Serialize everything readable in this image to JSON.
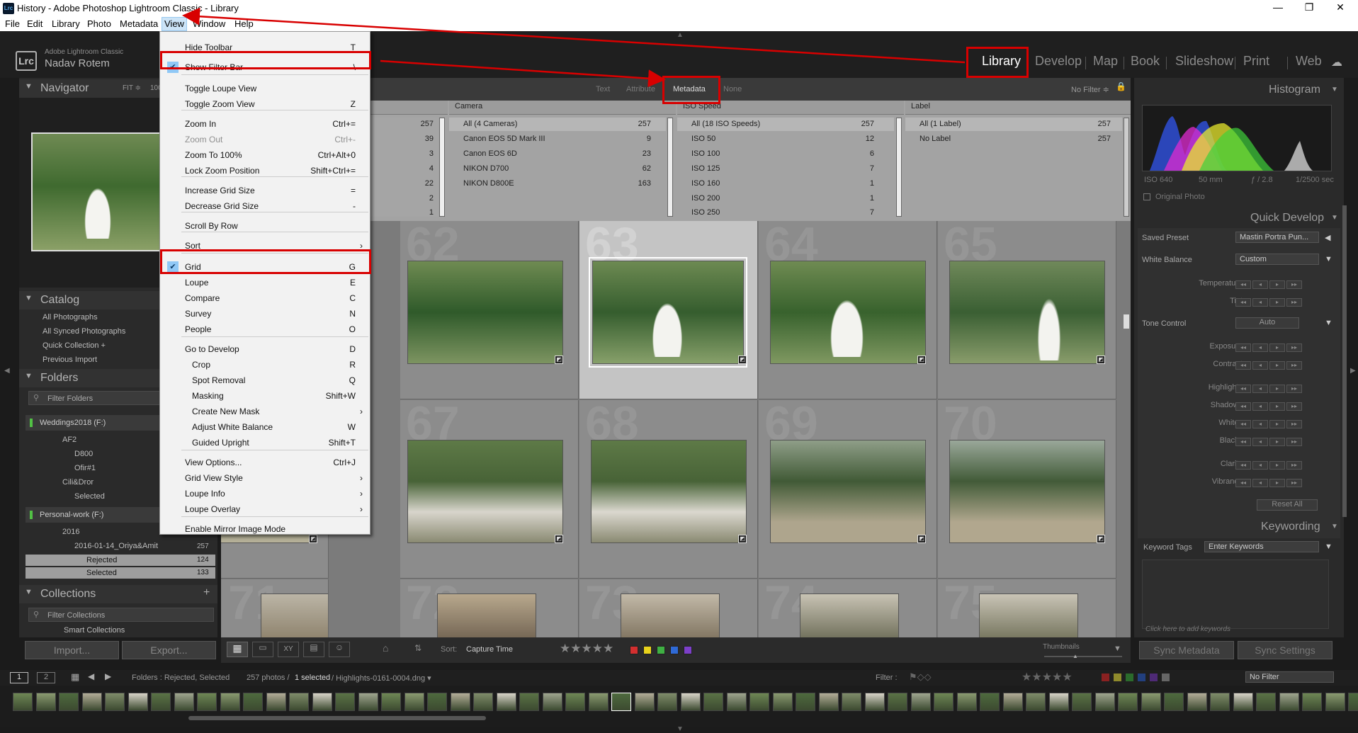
{
  "window": {
    "title": "History - Adobe Photoshop Lightroom Classic - Library",
    "minimize": "—",
    "maximize": "❐",
    "close": "✕"
  },
  "menubar": [
    "File",
    "Edit",
    "Library",
    "Photo",
    "Metadata",
    "View",
    "Window",
    "Help"
  ],
  "identity": {
    "app": "Adobe Lightroom Classic",
    "user": "Nadav Rotem",
    "logo": "Lrc"
  },
  "modules": [
    "Library",
    "Develop",
    "Map",
    "Book",
    "Slideshow",
    "Print",
    "Web"
  ],
  "navigator": {
    "title": "Navigator",
    "zoom_fit": "FIT ≑",
    "zoom_100": "100"
  },
  "catalog": {
    "title": "Catalog",
    "items": [
      "All Photographs",
      "All Synced Photographs",
      "Quick Collection  +",
      "Previous Import"
    ]
  },
  "folders": {
    "title": "Folders",
    "filter": "Filter Folders",
    "volume1": "Weddings2018 (F:)",
    "volume2": "Personal-work (F:)",
    "tree": [
      "AF2",
      "D800",
      "Ofir#1",
      "Cili&Dror",
      "Selected",
      "2016",
      "2016-01-14_Oriya&Amit",
      "Rejected",
      "Selected"
    ],
    "counts": [
      "257",
      "124",
      "133"
    ]
  },
  "collections": {
    "title": "Collections",
    "filter": "Filter Collections",
    "item": "Smart Collections"
  },
  "buttons": {
    "import": "Import...",
    "export": "Export..."
  },
  "filter_bar": {
    "text": "Text",
    "attribute": "Attribute",
    "metadata": "Metadata",
    "none": "None",
    "preset": "No Filter ≑"
  },
  "metadata": {
    "col0_counts": [
      "257",
      "39",
      "3",
      "4",
      "22",
      "2",
      "1"
    ],
    "camera": {
      "header": "Camera",
      "rows": [
        "All (4 Cameras)",
        "Canon EOS 5D Mark III",
        "Canon EOS 6D",
        "NIKON D700",
        "NIKON D800E"
      ],
      "counts": [
        "257",
        "9",
        "23",
        "62",
        "163"
      ]
    },
    "iso": {
      "header": "ISO Speed",
      "rows": [
        "All (18 ISO Speeds)",
        "ISO 50",
        "ISO 100",
        "ISO 125",
        "ISO 160",
        "ISO 200",
        "ISO 250"
      ],
      "counts": [
        "257",
        "12",
        "6",
        "7",
        "1",
        "1",
        "7"
      ]
    },
    "label": {
      "header": "Label",
      "rows": [
        "All (1 Label)",
        "No Label"
      ],
      "counts": [
        "257",
        "257"
      ]
    }
  },
  "grid": {
    "numbers": [
      "62",
      "63",
      "64",
      "65",
      "66",
      "67",
      "68",
      "69",
      "70",
      "71",
      "72",
      "73",
      "74",
      "75"
    ]
  },
  "toolbar": {
    "sort_label": "Sort:",
    "sort_value": "Capture Time",
    "stars": "★★★★★",
    "thumbnails": "Thumbnails"
  },
  "colors": {
    "red": "#d32f2f",
    "yellow": "#e8d21c",
    "green": "#3fb043",
    "blue": "#2f6ad6",
    "purple": "#7c3fc8",
    "highlight": "#d80000"
  },
  "histogram": {
    "title": "Histogram",
    "iso": "ISO 640",
    "focal": "50 mm",
    "aperture": "ƒ / 2.8",
    "shutter": "1/2500 sec",
    "original": "Original Photo"
  },
  "quick_develop": {
    "title": "Quick Develop",
    "saved_preset_label": "Saved Preset",
    "saved_preset_value": "Mastin Portra Pun...",
    "wb_label": "White Balance",
    "wb_value": "Custom",
    "temperature": "Temperature",
    "tint": "Tint",
    "tone_label": "Tone Control",
    "auto": "Auto",
    "exposure": "Exposure",
    "contrast": "Contrast",
    "highlights": "Highlights",
    "shadows": "Shadows",
    "whites": "Whites",
    "blacks": "Blacks",
    "clarity": "Clarity",
    "vibrance": "Vibrance",
    "reset": "Reset All"
  },
  "keywording": {
    "title": "Keywording",
    "tags_label": "Keyword Tags",
    "tags_value": "Enter Keywords",
    "hint": "Click here to add keywords"
  },
  "sync": {
    "metadata": "Sync Metadata",
    "settings": "Sync Settings"
  },
  "bottom": {
    "page1": "1",
    "page2": "2",
    "path": "Folders : Rejected, Selected",
    "count": "257 photos /",
    "selected": "1 selected",
    "file": "/ Highlights-0161-0004.dng ▾",
    "filter": "Filter :",
    "no_filter": "No Filter"
  },
  "view_menu": [
    {
      "label": "Hide Toolbar",
      "shortcut": "T"
    },
    {
      "label": "Show Filter Bar",
      "shortcut": "\\",
      "checked": true
    },
    {
      "label": "Toggle Loupe View",
      "shortcut": ""
    },
    {
      "label": "Toggle Zoom View",
      "shortcut": "Z"
    },
    {
      "label": "Zoom In",
      "shortcut": "Ctrl+="
    },
    {
      "label": "Zoom Out",
      "shortcut": "Ctrl+-",
      "disabled": true
    },
    {
      "label": "Zoom To 100%",
      "shortcut": "Ctrl+Alt+0"
    },
    {
      "label": "Lock Zoom Position",
      "shortcut": "Shift+Ctrl+="
    },
    {
      "label": "Increase Grid Size",
      "shortcut": "="
    },
    {
      "label": "Decrease Grid Size",
      "shortcut": "-"
    },
    {
      "label": "Scroll By Row",
      "shortcut": ""
    },
    {
      "label": "Sort",
      "shortcut": "",
      "submenu": true
    },
    {
      "label": "Grid",
      "shortcut": "G",
      "checked": true
    },
    {
      "label": "Loupe",
      "shortcut": "E"
    },
    {
      "label": "Compare",
      "shortcut": "C"
    },
    {
      "label": "Survey",
      "shortcut": "N"
    },
    {
      "label": "People",
      "shortcut": "O"
    },
    {
      "label": "Go to Develop",
      "shortcut": "D"
    },
    {
      "label": "Crop",
      "shortcut": "R",
      "indent": true
    },
    {
      "label": "Spot Removal",
      "shortcut": "Q",
      "indent": true
    },
    {
      "label": "Masking",
      "shortcut": "Shift+W",
      "indent": true
    },
    {
      "label": "Create New Mask",
      "shortcut": "",
      "indent": true,
      "submenu": true
    },
    {
      "label": "Adjust White Balance",
      "shortcut": "W",
      "indent": true
    },
    {
      "label": "Guided Upright",
      "shortcut": "Shift+T",
      "indent": true
    },
    {
      "label": "View Options...",
      "shortcut": "Ctrl+J"
    },
    {
      "label": "Grid View Style",
      "shortcut": "",
      "submenu": true
    },
    {
      "label": "Loupe Info",
      "shortcut": "",
      "submenu": true
    },
    {
      "label": "Loupe Overlay",
      "shortcut": "",
      "submenu": true
    },
    {
      "label": "Enable Mirror Image Mode",
      "shortcut": ""
    }
  ]
}
